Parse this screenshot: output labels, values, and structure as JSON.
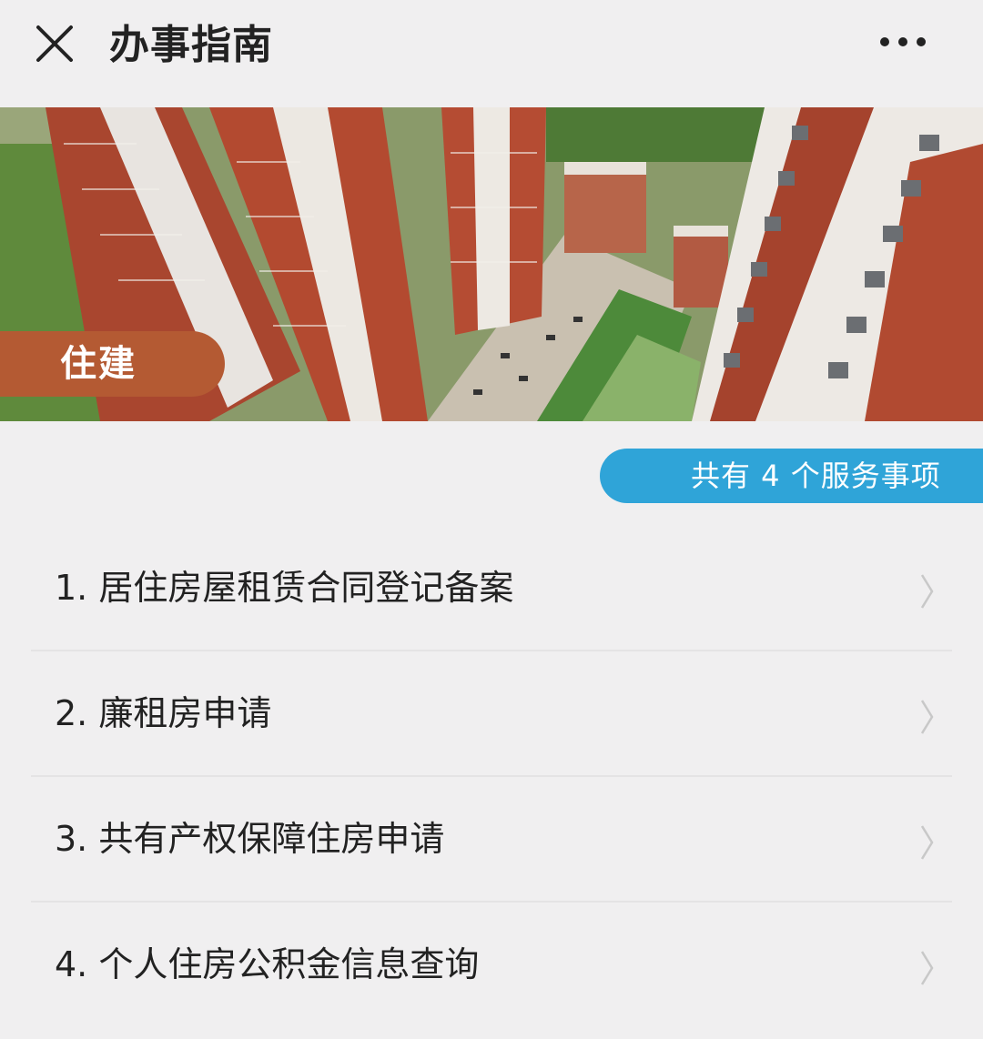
{
  "header": {
    "title": "办事指南",
    "close_icon": "close-icon",
    "more_icon": "more-icon"
  },
  "banner": {
    "category_label": "住建",
    "image_subject": "residential-buildings-photo"
  },
  "summary": {
    "count_text": "共有 4 个服务事项"
  },
  "services": [
    {
      "label": "1. 居住房屋租赁合同登记备案"
    },
    {
      "label": "2. 廉租房申请"
    },
    {
      "label": "3. 共有产权保障住房申请"
    },
    {
      "label": "4. 个人住房公积金信息查询"
    }
  ],
  "colors": {
    "background": "#f0eff0",
    "tag": "#b45a33",
    "badge": "#2fa4d8",
    "chevron": "#c8c8c8"
  }
}
